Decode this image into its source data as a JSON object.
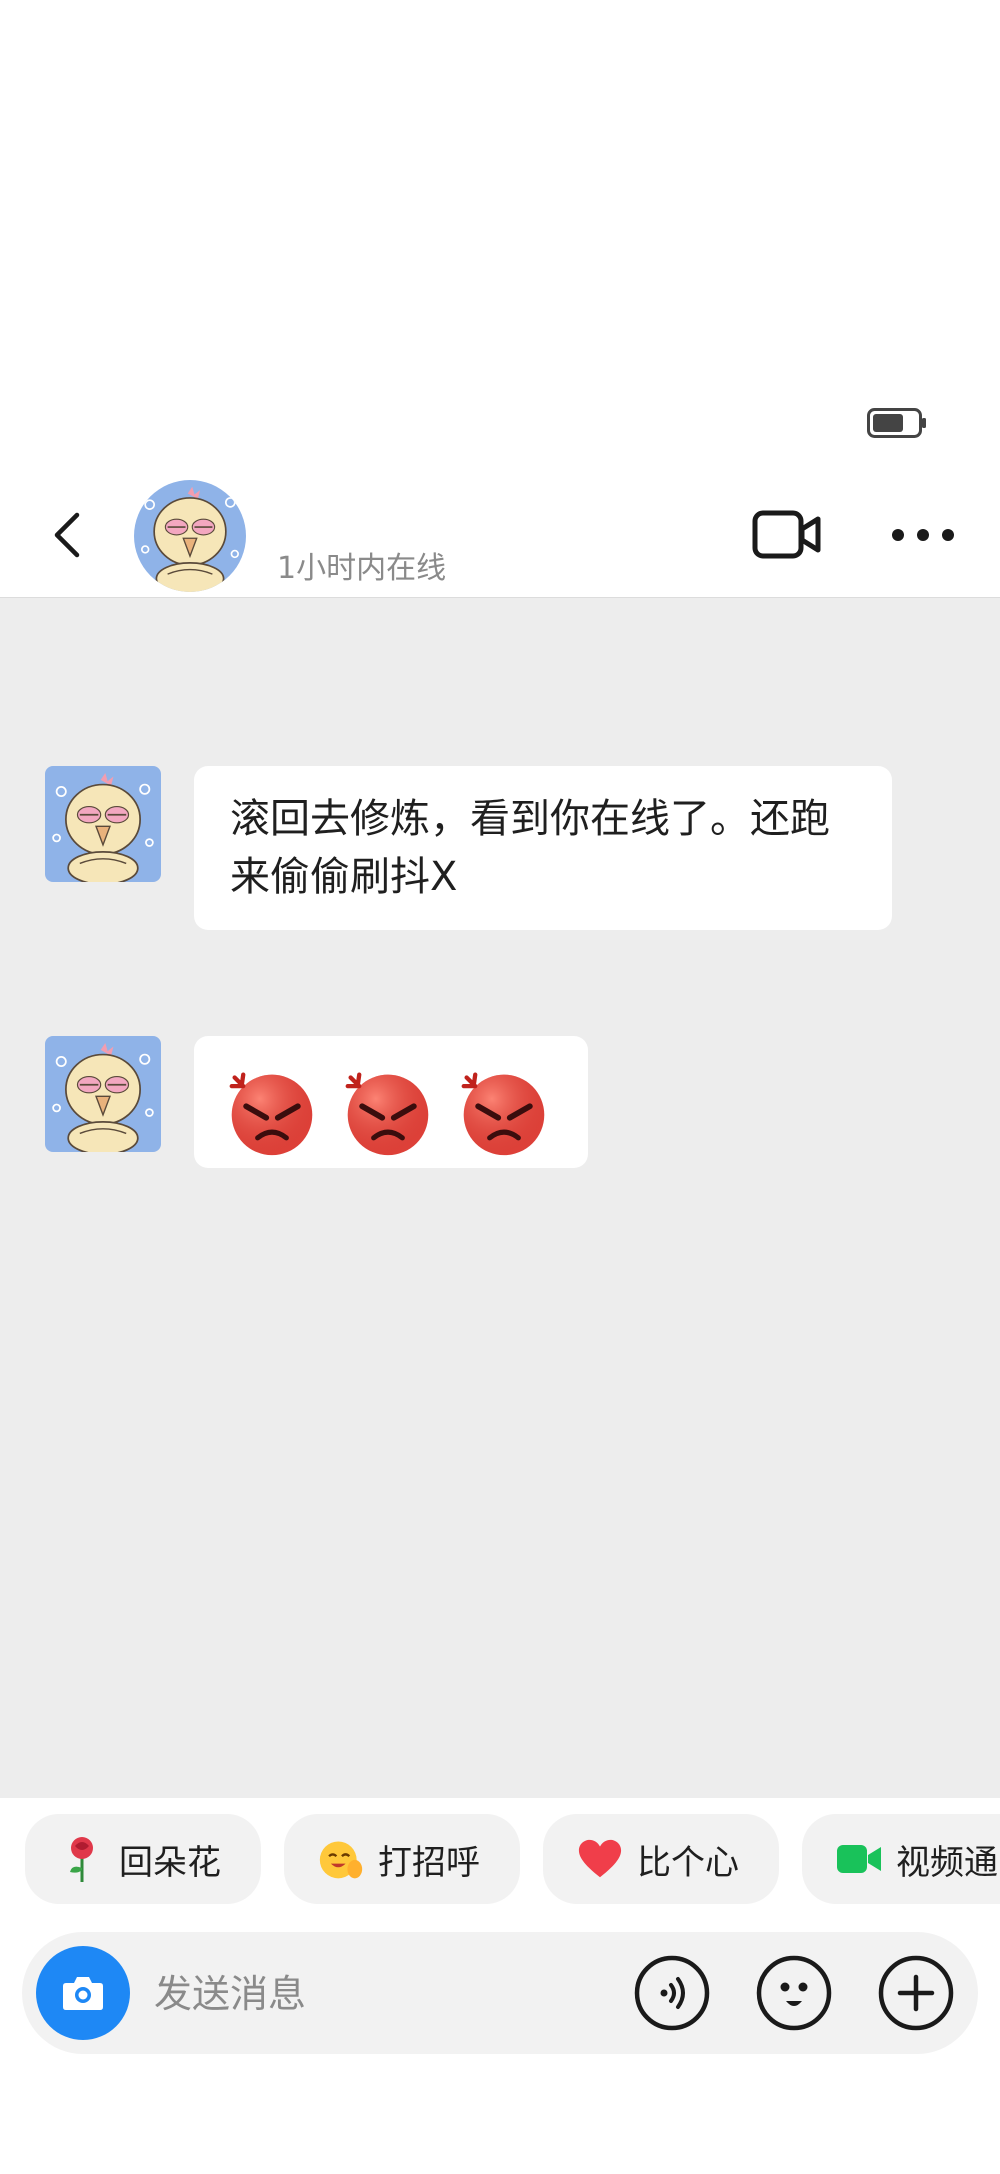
{
  "header": {
    "online_status": "1小时内在线"
  },
  "messages": [
    {
      "type": "text",
      "text": "滚回去修炼，看到你在线了。还跑来偷偷刷抖X"
    },
    {
      "type": "emoji",
      "emojis": [
        "angry-face-emoji",
        "angry-face-emoji",
        "angry-face-emoji"
      ]
    }
  ],
  "quick_replies": [
    {
      "label": "回朵花",
      "icon": "rose-icon"
    },
    {
      "label": "打招呼",
      "icon": "greeting-emoji-icon"
    },
    {
      "label": "比个心",
      "icon": "heart-icon"
    },
    {
      "label": "视频通",
      "icon": "video-camera-icon"
    }
  ],
  "input": {
    "placeholder": "发送消息"
  },
  "colors": {
    "chat_background": "#ededed",
    "camera_button": "#1e88f5",
    "heart": "#f03e4a",
    "video_green": "#19c25a"
  }
}
